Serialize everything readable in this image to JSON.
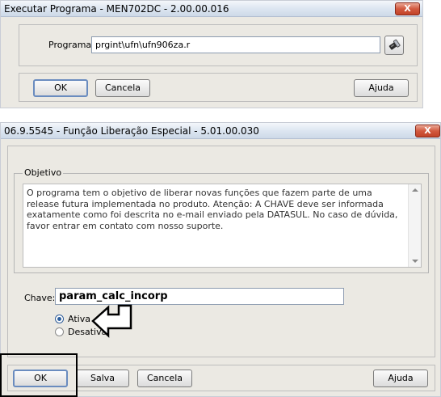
{
  "dialog1": {
    "title": "Executar Programa - MEN702DC - 2.00.00.016",
    "close_label": "X",
    "program_label": "Programa:",
    "program_value": "prgint\\ufn\\ufn906za.r",
    "buttons": {
      "ok": "OK",
      "cancel": "Cancela",
      "help": "Ajuda"
    }
  },
  "dialog2": {
    "title": "06.9.5545 - Função Liberação Especial - 5.01.00.030",
    "close_label": "X",
    "objective_legend": "Objetivo",
    "objective_text": "O programa tem o objetivo de liberar novas funções que fazem parte de uma release futura implementada no produto. Atenção: A CHAVE deve ser informada exatamente como foi descrita no e-mail enviado pela DATASUL. No caso de dúvida, favor entrar em contato com nosso suporte.",
    "key_label": "Chave:",
    "key_value": "param_calc_incorp",
    "radios": {
      "ativa": "Ativa",
      "desativa": "Desativa",
      "selected": "Ativa"
    },
    "buttons": {
      "ok": "OK",
      "save": "Salva",
      "cancel": "Cancela",
      "help": "Ajuda"
    }
  }
}
